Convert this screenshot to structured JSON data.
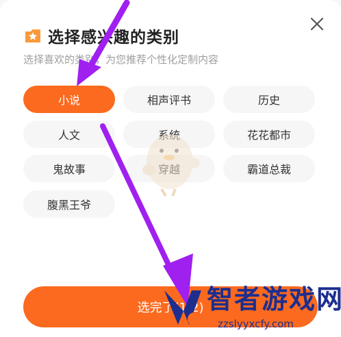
{
  "dialog": {
    "title": "选择感兴趣的类别",
    "subtitle": "选择喜欢的类别，为您推荐个性化定制内容",
    "close_icon": "close-icon",
    "title_icon": "star-folder-icon"
  },
  "categories": [
    {
      "label": "小说",
      "selected": true
    },
    {
      "label": "相声评书",
      "selected": false
    },
    {
      "label": "历史",
      "selected": false
    },
    {
      "label": "人文",
      "selected": false
    },
    {
      "label": "系统",
      "selected": false
    },
    {
      "label": "花花都市",
      "selected": false
    },
    {
      "label": "鬼故事",
      "selected": false
    },
    {
      "label": "穿越",
      "selected": false
    },
    {
      "label": "霸道总裁",
      "selected": false
    },
    {
      "label": "腹黑王爷",
      "selected": false
    }
  ],
  "bottom_button": {
    "label": "选完了(1/2)"
  },
  "watermark": {
    "name": "智者游戏网",
    "url": "zzslyyxcfy.com"
  },
  "colors": {
    "accent": "#fb6a1e",
    "arrow": "#a020f0",
    "chip_bg": "#f6f6f6"
  }
}
